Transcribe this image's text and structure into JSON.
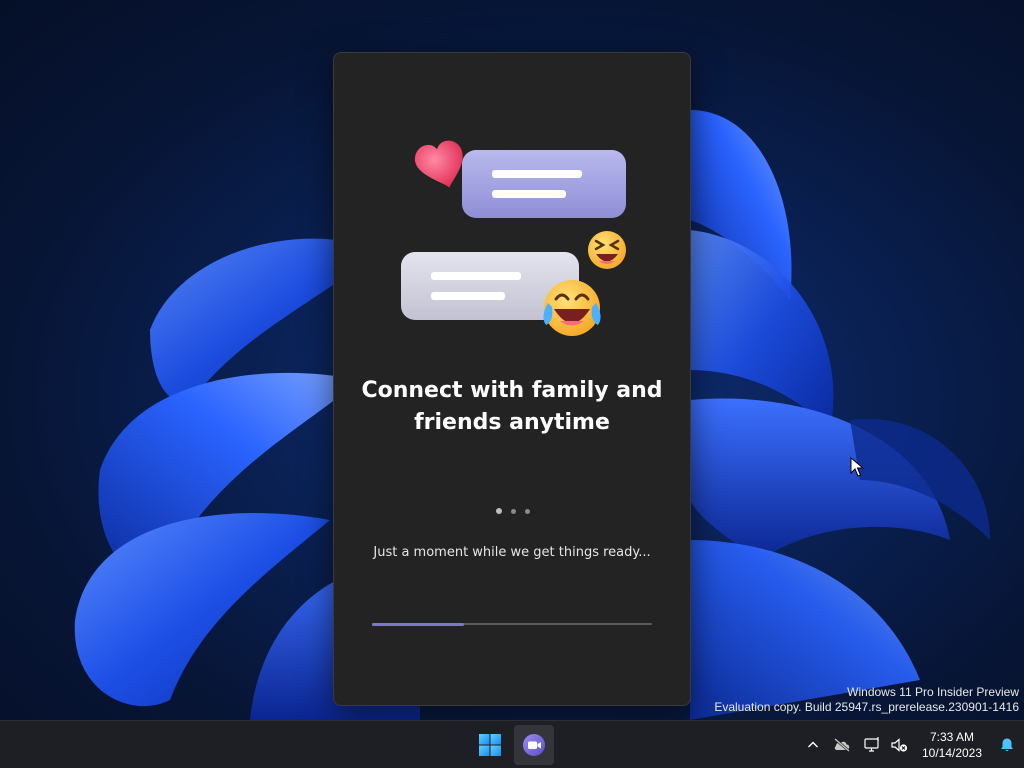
{
  "dialog": {
    "headline": "Connect with family and friends anytime",
    "status": "Just a moment while we get things ready...",
    "progress": 0.33,
    "pager": {
      "count": 3,
      "active": 0
    },
    "accent": "#7b78c8"
  },
  "watermark": {
    "line1": "Windows 11 Pro Insider Preview",
    "line2": "Evaluation copy. Build 25947.rs_prerelease.230901-1416"
  },
  "taskbar": {
    "start_icon": "windows-start-icon",
    "apps": [
      {
        "icon": "teams-chat-icon",
        "active": true
      }
    ],
    "tray": {
      "overflow_icon": "chevron-up-icon",
      "icons": [
        "onedrive-offline-icon",
        "network-disconnected-icon",
        "volume-muted-icon"
      ],
      "time": "7:33 AM",
      "date": "10/14/2023",
      "notification_icon": "bell-icon"
    }
  }
}
